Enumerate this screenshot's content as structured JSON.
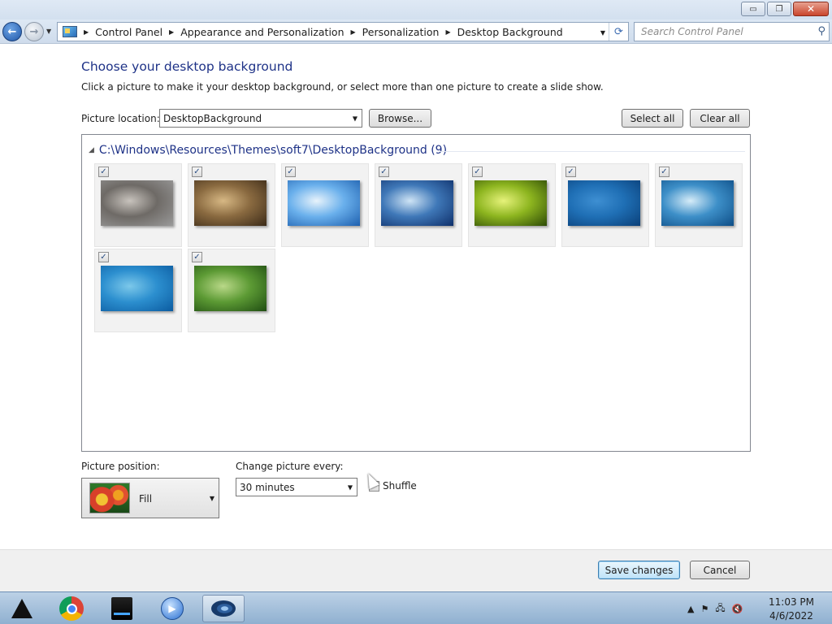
{
  "window": {
    "minimize_glyph": "▭",
    "maximize_glyph": "❐",
    "close_glyph": "✕"
  },
  "nav": {
    "back_glyph": "←",
    "forward_glyph": "→",
    "breadcrumb": [
      "Control Panel",
      "Appearance and Personalization",
      "Personalization",
      "Desktop Background"
    ],
    "search_placeholder": "Search Control Panel"
  },
  "main": {
    "title": "Choose your desktop background",
    "subtitle": "Click a picture to make it your desktop background, or select more than one picture to create a slide show.",
    "picture_location_label": "Picture location:",
    "picture_location_value": "DesktopBackground",
    "browse_button": "Browse...",
    "select_all_button": "Select all",
    "clear_all_button": "Clear all",
    "group_header": "C:\\Windows\\Resources\\Themes\\soft7\\DesktopBackground (9)",
    "pictures": [
      {
        "checked": true,
        "colors": [
          "#9a9a9a",
          "#6e6a66",
          "#c8c3bd"
        ]
      },
      {
        "checked": true,
        "colors": [
          "#3b2a18",
          "#8a6a40",
          "#d7b884"
        ]
      },
      {
        "checked": true,
        "colors": [
          "#1d5fae",
          "#6ab0ec",
          "#e8f3fb"
        ]
      },
      {
        "checked": true,
        "colors": [
          "#0e2f6a",
          "#3f78b8",
          "#cfe4f5"
        ]
      },
      {
        "checked": true,
        "colors": [
          "#2d4a06",
          "#8db51f",
          "#e6f27a"
        ]
      },
      {
        "checked": true,
        "colors": [
          "#0a3f78",
          "#1f6fb5",
          "#3e8fd2"
        ]
      },
      {
        "checked": true,
        "colors": [
          "#0d4d86",
          "#3d8fc8",
          "#d6ecf8"
        ]
      },
      {
        "checked": true,
        "colors": [
          "#0b5ba0",
          "#2c8fcf",
          "#7cc8ea"
        ]
      },
      {
        "checked": true,
        "colors": [
          "#1f4d12",
          "#5c9a34",
          "#b9d888"
        ]
      }
    ],
    "picture_position_label": "Picture position:",
    "picture_position_value": "Fill",
    "change_picture_label": "Change picture every:",
    "change_picture_value": "30 minutes",
    "shuffle_label": "Shuffle",
    "shuffle_checked": true
  },
  "footer": {
    "save_button": "Save changes",
    "cancel_button": "Cancel"
  },
  "taskbar": {
    "apps": [
      "app-logo-icon",
      "chrome-icon",
      "usb-drive-icon",
      "media-player-icon",
      "swirl-app-icon"
    ],
    "tray_icons": [
      "show-hidden-icons",
      "flag-icon",
      "network-icon",
      "volume-muted-icon"
    ],
    "time": "11:03 PM",
    "date": "4/6/2022"
  }
}
